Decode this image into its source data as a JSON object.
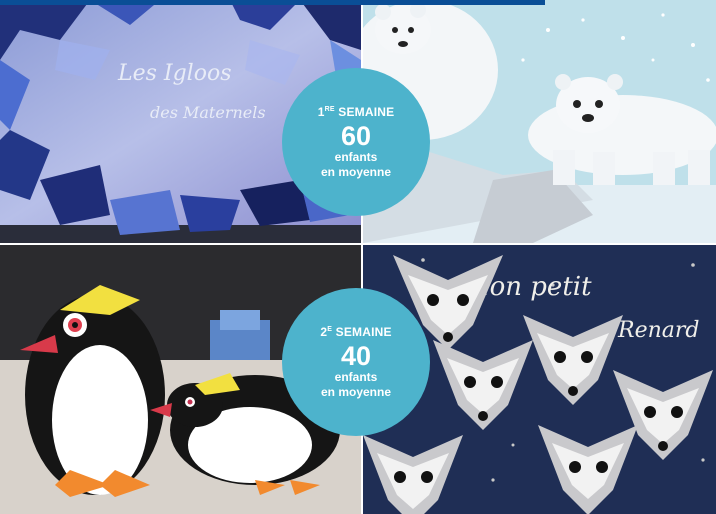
{
  "badges": [
    {
      "ordinal": "1",
      "ordinal_suffix": "RE",
      "week_word": "SEMAINE",
      "count": "60",
      "line1": "enfants",
      "line2": "en moyenne"
    },
    {
      "ordinal": "2",
      "ordinal_suffix": "E",
      "week_word": "SEMAINE",
      "count": "40",
      "line1": "enfants",
      "line2": "en moyenne"
    }
  ],
  "artworks": {
    "top_left_title_line1": "Les Igloos",
    "top_left_title_line2": "des Maternels",
    "bottom_right_title_line1": "Mon petit",
    "bottom_right_title_line2": "Renard"
  },
  "colors": {
    "badge": "#4db3cc",
    "top_bar": "#0a4e96"
  },
  "icons": [
    "polar-bear",
    "penguin",
    "fox"
  ]
}
